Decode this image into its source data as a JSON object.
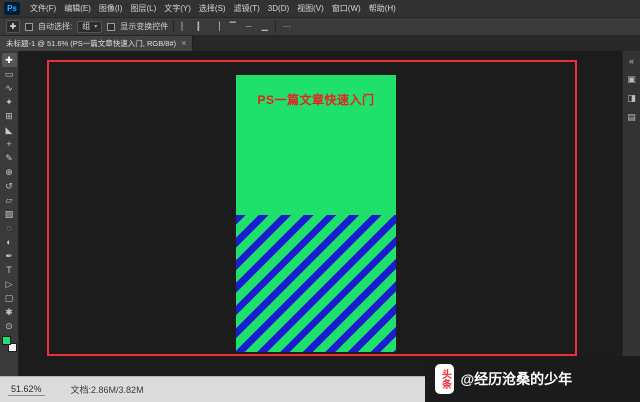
{
  "app": {
    "logo": "Ps"
  },
  "menubar": {
    "items": [
      "文件(F)",
      "编辑(E)",
      "图像(I)",
      "图层(L)",
      "文字(Y)",
      "选择(S)",
      "滤镜(T)",
      "3D(D)",
      "视图(V)",
      "窗口(W)",
      "帮助(H)"
    ]
  },
  "options": {
    "tool_icon": "✚",
    "auto_select_label": "自动选择:",
    "auto_select_value": "组",
    "dropdown_caret": "▾",
    "show_transform_label": "显示变换控件",
    "align_icons": [
      "▏",
      "▎",
      "▕",
      "▔",
      "─",
      "▁"
    ],
    "more_icon": "⋯"
  },
  "tab": {
    "title": "未标题-1 @ 51.6% (PS一篇文章快速入门, RGB/8#)",
    "close_label": "×"
  },
  "tools": [
    {
      "name": "move-tool",
      "glyph": "✚"
    },
    {
      "name": "rectangular-marquee-tool",
      "glyph": "▭"
    },
    {
      "name": "lasso-tool",
      "glyph": "∿"
    },
    {
      "name": "quick-selection-tool",
      "glyph": "✦"
    },
    {
      "name": "crop-tool",
      "glyph": "⊞"
    },
    {
      "name": "eyedropper-tool",
      "glyph": "◣"
    },
    {
      "name": "healing-brush-tool",
      "glyph": "+"
    },
    {
      "name": "brush-tool",
      "glyph": "✎"
    },
    {
      "name": "clone-stamp-tool",
      "glyph": "⊕"
    },
    {
      "name": "history-brush-tool",
      "glyph": "↺"
    },
    {
      "name": "eraser-tool",
      "glyph": "▱"
    },
    {
      "name": "gradient-tool",
      "glyph": "▨"
    },
    {
      "name": "blur-tool",
      "glyph": "◌"
    },
    {
      "name": "dodge-tool",
      "glyph": "◐"
    },
    {
      "name": "pen-tool",
      "glyph": "✒"
    },
    {
      "name": "type-tool",
      "glyph": "T"
    },
    {
      "name": "path-selection-tool",
      "glyph": "▷"
    },
    {
      "name": "rectangle-tool",
      "glyph": "▢"
    },
    {
      "name": "hand-tool",
      "glyph": "✱"
    },
    {
      "name": "zoom-tool",
      "glyph": "⊙"
    }
  ],
  "right_panel": {
    "icons": [
      "«",
      "▣",
      "◨",
      "▤"
    ]
  },
  "canvas": {
    "poster_title": "PS一篇文章快速入门",
    "colors": {
      "frame_red": "#f23030",
      "poster_green": "#1fe06a",
      "stripe_blue": "#1a1ccf",
      "title_red": "#e8201f",
      "wm_red": "#ec2f36"
    }
  },
  "statusbar": {
    "zoom": "51.62%",
    "doc_info": "文档:2.86M/3.82M"
  },
  "watermark": {
    "logo": "头条",
    "handle": "@经历沧桑的少年"
  }
}
